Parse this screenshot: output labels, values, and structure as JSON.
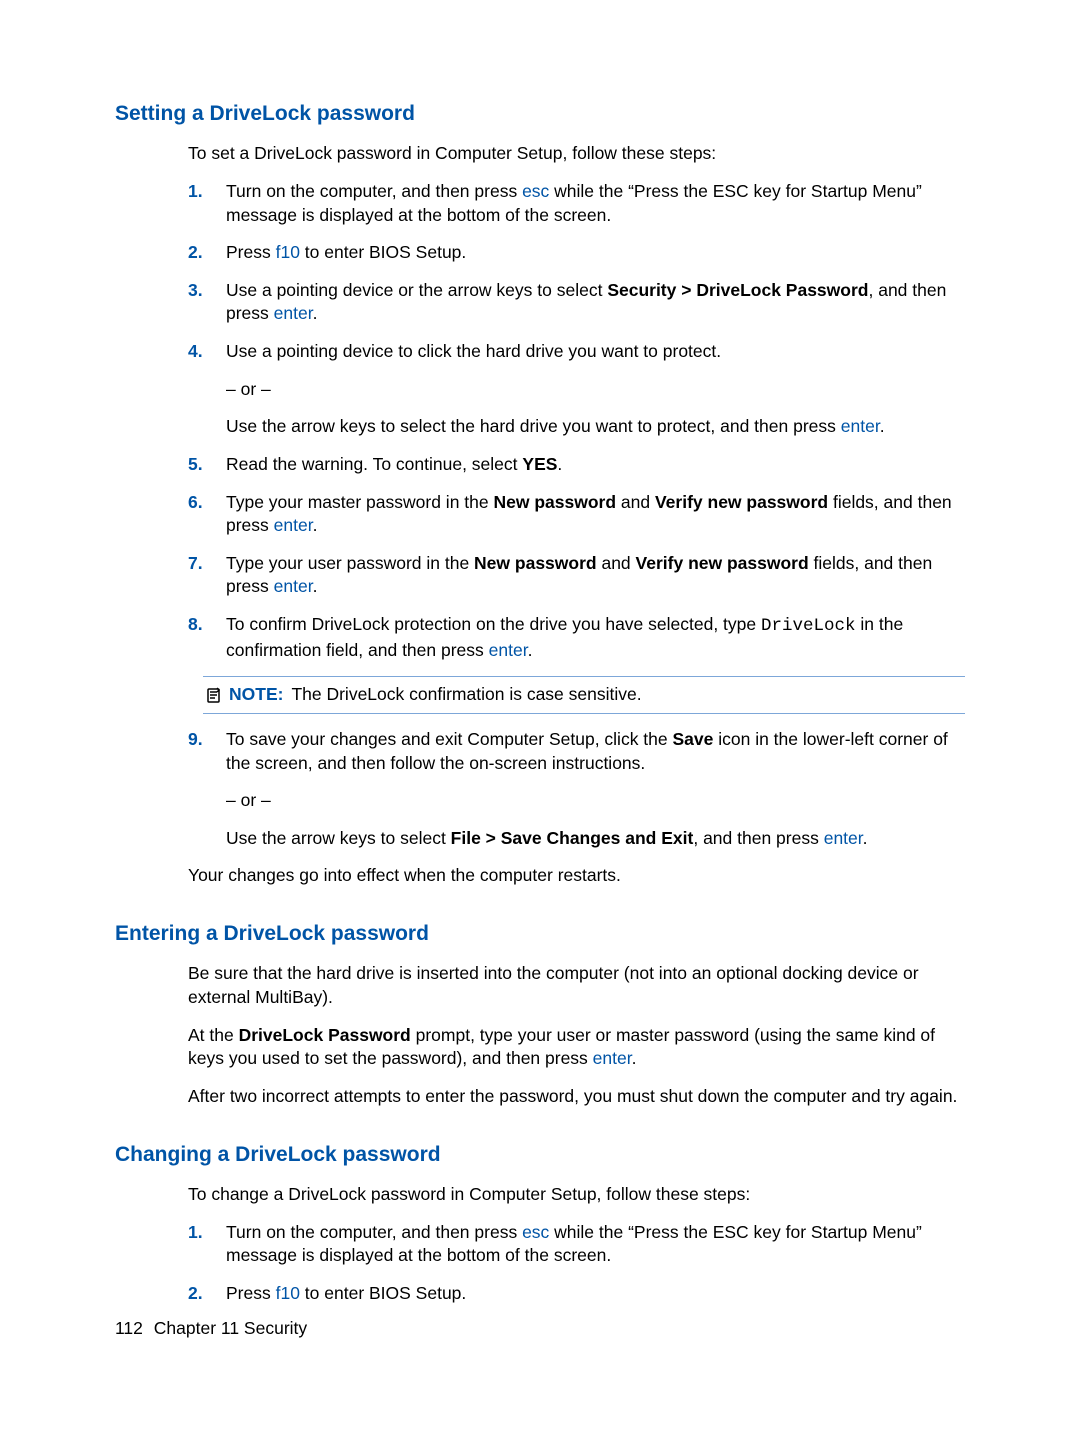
{
  "keys": {
    "esc": "esc",
    "f10": "f10",
    "enter": "enter"
  },
  "note": {
    "label": "NOTE:",
    "text": "The DriveLock confirmation is case sensitive."
  },
  "footer": {
    "page": "112",
    "chapter": "Chapter 11   Security"
  },
  "sections": {
    "setting": {
      "heading": "Setting a DriveLock password",
      "intro": "To set a DriveLock password in Computer Setup, follow these steps:",
      "after": "Your changes go into effect when the computer restarts.",
      "steps": {
        "s1": {
          "num": "1.",
          "a": "Turn on the computer, and then press ",
          "b": " while the “Press the ESC key for Startup Menu” message is displayed at the bottom of the screen."
        },
        "s2": {
          "num": "2.",
          "a": "Press ",
          "b": " to enter BIOS Setup."
        },
        "s3": {
          "num": "3.",
          "a": "Use a pointing device or the arrow keys to select ",
          "bold": "Security > DriveLock Password",
          "b": ", and then press ",
          "c": "."
        },
        "s4": {
          "num": "4.",
          "a": "Use a pointing device to click the hard drive you want to protect.",
          "or": "– or –",
          "b": "Use the arrow keys to select the hard drive you want to protect, and then press ",
          "c": "."
        },
        "s5": {
          "num": "5.",
          "a": "Read the warning. To continue, select ",
          "bold": "YES",
          "b": "."
        },
        "s6": {
          "num": "6.",
          "a": "Type your master password in the ",
          "bold1": "New password",
          "mid": " and ",
          "bold2": "Verify new password",
          "b": " fields, and then press ",
          "c": "."
        },
        "s7": {
          "num": "7.",
          "a": "Type your user password in the ",
          "bold1": "New password",
          "mid": " and ",
          "bold2": "Verify new password",
          "b": " fields, and then press ",
          "c": "."
        },
        "s8": {
          "num": "8.",
          "a": "To confirm DriveLock protection on the drive you have selected, type ",
          "mono": "DriveLock",
          "b": " in the confirmation field, and then press ",
          "c": "."
        },
        "s9": {
          "num": "9.",
          "a": "To save your changes and exit Computer Setup, click the ",
          "bold1": "Save",
          "b": " icon in the lower-left corner of the screen, and then follow the on-screen instructions.",
          "or": "– or –",
          "d": "Use the arrow keys to select ",
          "bold2": "File > Save Changes and Exit",
          "e": ", and then press ",
          "f": "."
        }
      }
    },
    "entering": {
      "heading": "Entering a DriveLock password",
      "p1": "Be sure that the hard drive is inserted into the computer (not into an optional docking device or external MultiBay).",
      "p2a": "At the ",
      "p2bold": "DriveLock Password",
      "p2b": " prompt, type your user or master password (using the same kind of keys you used to set the password), and then press ",
      "p2c": ".",
      "p3": "After two incorrect attempts to enter the password, you must shut down the computer and try again."
    },
    "changing": {
      "heading": "Changing a DriveLock password",
      "intro": "To change a DriveLock password in Computer Setup, follow these steps:",
      "steps": {
        "s1": {
          "num": "1.",
          "a": "Turn on the computer, and then press ",
          "b": " while the “Press the ESC key for Startup Menu” message is displayed at the bottom of the screen."
        },
        "s2": {
          "num": "2.",
          "a": "Press ",
          "b": " to enter BIOS Setup."
        }
      }
    }
  }
}
